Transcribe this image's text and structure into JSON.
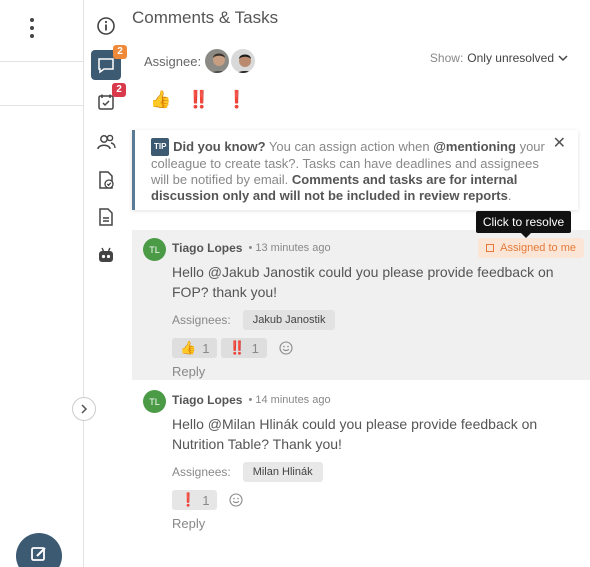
{
  "panel": {
    "title": "Comments & Tasks"
  },
  "assignee_filter": {
    "label": "Assignee:"
  },
  "show_filter": {
    "label": "Show:",
    "value": "Only unresolved"
  },
  "rail": {
    "comments_badge": "2",
    "tasks_badge": "2"
  },
  "reaction_filters": [
    "👍",
    "‼️",
    "❗"
  ],
  "tip": {
    "tag": "TIP",
    "heading": "Did you know?",
    "text_1": " You can assign action when ",
    "mention": "@mentioning",
    "text_2": " your colleague to create task?. Tasks can have deadlines and assignees will be notified by email. ",
    "bold_note": "Comments and tasks are for internal discussion only and will not be included in review reports",
    "text_3": "."
  },
  "tooltip": "Click to resolve",
  "comments": [
    {
      "initials": "TL",
      "author": "Tiago Lopes",
      "time": "13 minutes ago",
      "text": "Hello @Jakub Janostik could you please provide feedback on FOP? thank you!",
      "assignees_label": "Assignees:",
      "assignee": "Jakub Janostik",
      "task_status": "Assigned to me",
      "reactions": [
        {
          "emoji": "👍",
          "count": "1"
        },
        {
          "emoji": "‼️",
          "count": "1"
        }
      ],
      "reply": "Reply"
    },
    {
      "initials": "TL",
      "author": "Tiago Lopes",
      "time": "14 minutes ago",
      "text": "Hello @Milan Hlinák  could you please provide feedback on Nutrition Table? Thank you!",
      "assignees_label": "Assignees:",
      "assignee": "Milan Hlinák",
      "reactions": [
        {
          "emoji": "❗",
          "count": "1"
        }
      ],
      "reply": "Reply"
    }
  ],
  "colors": {
    "accent": "#3d5a73",
    "badge_orange": "#ee8a3a",
    "badge_red": "#d8394b",
    "avatar_green": "#4a9a46",
    "assigned_bg": "#fbe5d6",
    "assigned_text": "#e37a3a"
  }
}
